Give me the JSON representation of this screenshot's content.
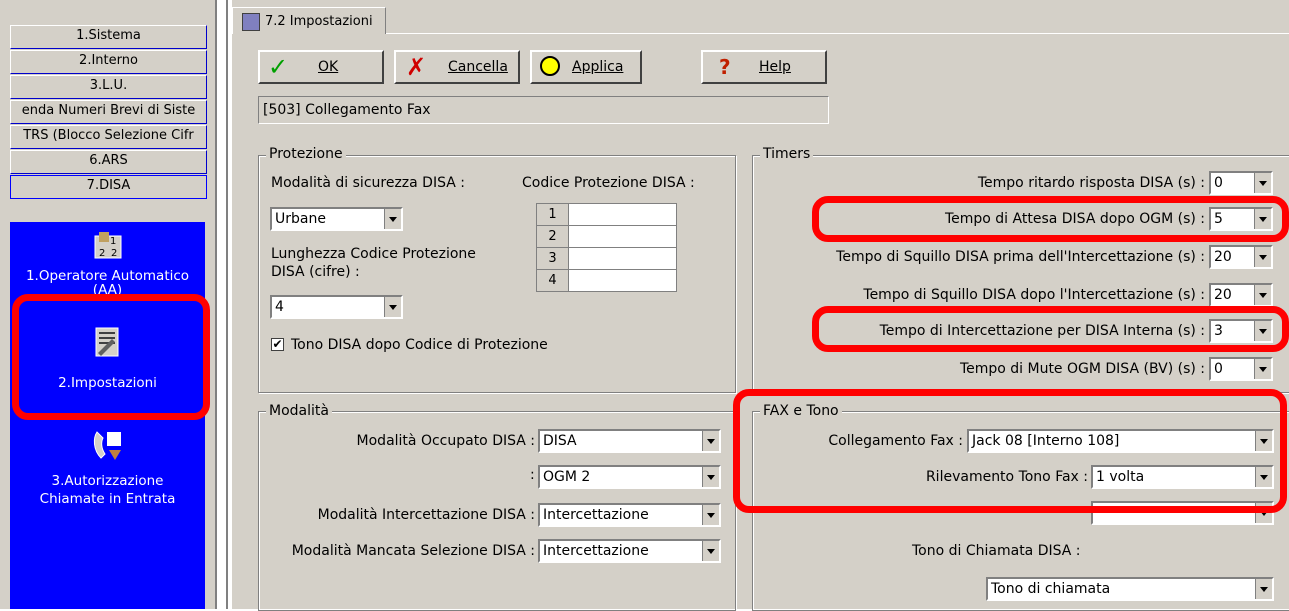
{
  "sidebar": {
    "nav": [
      "1.Sistema",
      "2.Interno",
      "3.L.U.",
      "enda Numeri Brevi di Siste",
      "TRS (Blocco Selezione Cifr",
      "6.ARS",
      "7.DISA"
    ],
    "items": [
      {
        "label1": "1.Operatore Automatico",
        "label2": "(AA)"
      },
      {
        "label1": "2.Impostazioni",
        "label2": ""
      },
      {
        "label1": "3.Autorizzazione",
        "label2": "Chiamate in Entrata"
      }
    ]
  },
  "tab": {
    "label": "7.2 Impostazioni"
  },
  "toolbar": {
    "ok": "OK",
    "cancel": "Cancella",
    "apply": "Applica",
    "help": "Help"
  },
  "info_bar": "[503] Collegamento Fax",
  "protezione": {
    "title": "Protezione",
    "security_label": "Modalità di sicurezza DISA :",
    "security_value": "Urbane",
    "code_label": "Codice Protezione DISA :",
    "codes": [
      "1",
      "2",
      "3",
      "4"
    ],
    "length_label1": "Lunghezza Codice Protezione",
    "length_label2": "DISA (cifre) :",
    "length_value": "4",
    "tone_label": "Tono DISA dopo Codice di Protezione",
    "tone_checked": "✔"
  },
  "timers": {
    "title": "Timers",
    "rows": [
      {
        "label": "Tempo ritardo risposta DISA (s) :",
        "value": "0"
      },
      {
        "label": "Tempo di Attesa DISA dopo OGM (s) :",
        "value": "5"
      },
      {
        "label": "Tempo di Squillo DISA prima dell'Intercettazione (s) :",
        "value": "20"
      },
      {
        "label": "Tempo di Squillo DISA dopo l'Intercettazione (s) :",
        "value": "20"
      },
      {
        "label": "Tempo di Intercettazione per DISA Interna (s) :",
        "value": "3"
      },
      {
        "label": "Tempo di Mute OGM DISA (BV) (s) :",
        "value": "0"
      }
    ]
  },
  "modalita": {
    "title": "Modalità",
    "busy_label": "Modalità Occupato DISA :",
    "busy_value": "DISA",
    "busy_value2": "OGM 2",
    "intercept_label": "Modalità Intercettazione DISA :",
    "intercept_value": "Intercettazione",
    "missed_label": "Modalità Mancata Selezione DISA :",
    "missed_value": "Intercettazione"
  },
  "fax": {
    "title": "FAX e Tono",
    "conn_label": "Collegamento Fax :",
    "conn_value": "Jack 08 [Interno 108]",
    "detect_label": "Rilevamento Tono Fax :",
    "detect_value": "1 volta",
    "call_tone_label": "Tono di Chiamata DISA :",
    "call_tone_value": "Tono di chiamata"
  },
  "colors": {
    "highlight": "#ff0000",
    "sidebar_blue": "#0000ff",
    "face": "#d4d0c8"
  }
}
